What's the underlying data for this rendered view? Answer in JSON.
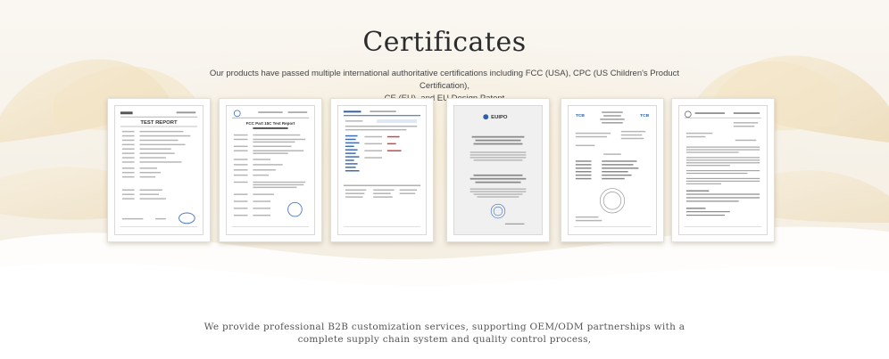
{
  "heading": {
    "title": "Certificates",
    "subtitle_line1": "Our products have passed multiple international authoritative certifications including FCC (USA), CPC (US Children's Product Certification),",
    "subtitle_line2": "CE (EU), and EU Design Patent"
  },
  "certificates": [
    {
      "heading": "TEST REPORT",
      "icon": "test-report-document"
    },
    {
      "heading": "FCC Part 15C Test Report",
      "icon": "fcc-report-document"
    },
    {
      "heading": "",
      "icon": "cpc-certificate-document"
    },
    {
      "heading": "EUIPO",
      "icon": "eu-design-patent-document"
    },
    {
      "heading": "TCB",
      "icon": "ce-test-report-document"
    },
    {
      "heading": "",
      "icon": "design-registration-document"
    }
  ],
  "footer": {
    "line1": "We provide professional B2B customization services, supporting OEM/ODM partnerships with a",
    "line2": "complete supply chain system and quality control process,"
  },
  "colors": {
    "background": "#f5efe4",
    "ribbon": "#f1e2c2",
    "title": "#2c2c2c"
  }
}
